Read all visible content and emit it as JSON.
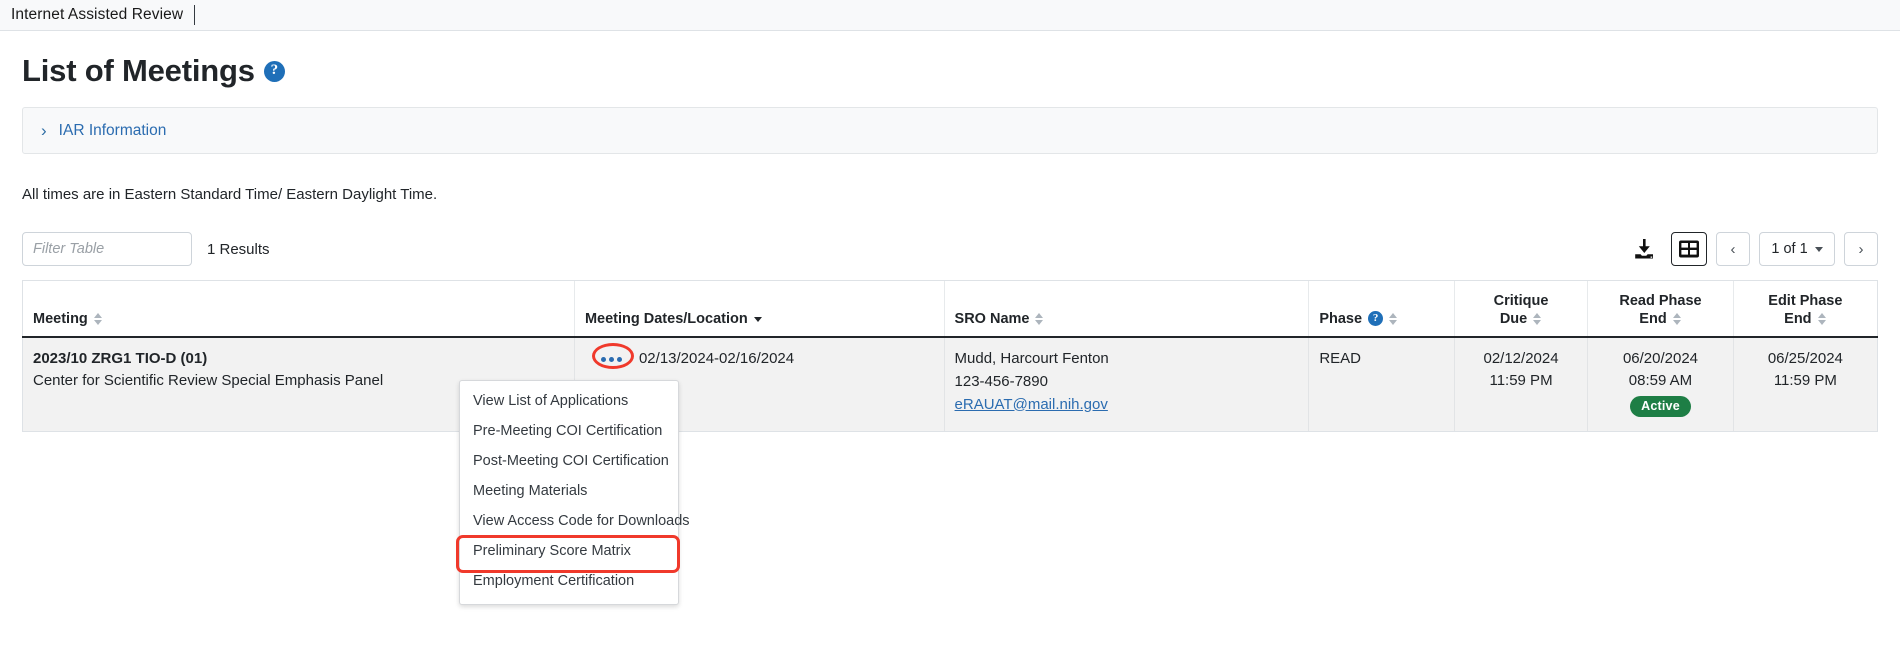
{
  "appbar": {
    "title": "Internet Assisted Review"
  },
  "page": {
    "title": "List of Meetings",
    "help_icon": "question-mark-icon",
    "accordion_label": "IAR Information",
    "times_note": "All times are in Eastern Standard Time/ Eastern Daylight Time."
  },
  "toolbar": {
    "filter_placeholder": "Filter Table",
    "filter_value": "",
    "results_count": "1 Results",
    "download_icon": "download-icon",
    "grid_icon": "grid-view-icon",
    "prev_label": "‹",
    "next_label": "›",
    "page_indicator": "1 of 1"
  },
  "table": {
    "columns": [
      {
        "label": "Meeting",
        "align": "left",
        "sort": "none"
      },
      {
        "label": "Meeting Dates/Location",
        "align": "left",
        "sort": "desc"
      },
      {
        "label": "SRO Name",
        "align": "left",
        "sort": "none"
      },
      {
        "label": "Phase",
        "align": "left",
        "sort": "none",
        "help": true
      },
      {
        "label_line1": "Critique",
        "label_line2": "Due",
        "align": "center",
        "sort": "none"
      },
      {
        "label_line1": "Read Phase",
        "label_line2": "End",
        "align": "center",
        "sort": "none"
      },
      {
        "label_line1": "Edit Phase",
        "label_line2": "End",
        "align": "center",
        "sort": "none"
      }
    ],
    "rows": [
      {
        "meeting_id": "2023/10 ZRG1 TIO-D (01)",
        "meeting_name": "Center for Scientific Review Special Emphasis Panel",
        "dates": "02/13/2024-02/16/2024",
        "sro_name": "Mudd, Harcourt Fenton",
        "sro_phone": "123-456-7890",
        "sro_email": "eRAUAT@mail.nih.gov",
        "phase": "READ",
        "critique_due_date": "02/12/2024",
        "critique_due_time": "11:59 PM",
        "read_phase_end_date": "06/20/2024",
        "read_phase_end_time": "08:59 AM",
        "read_phase_badge": "Active",
        "edit_phase_end_date": "06/25/2024",
        "edit_phase_end_time": "11:59 PM"
      }
    ]
  },
  "dropdown": {
    "items": [
      {
        "label": "View List of Applications",
        "highlighted": false
      },
      {
        "label": "Pre-Meeting COI Certification",
        "highlighted": false
      },
      {
        "label": "Post-Meeting COI Certification",
        "highlighted": false
      },
      {
        "label": "Meeting Materials",
        "highlighted": false
      },
      {
        "label": "View Access Code for Downloads",
        "highlighted": false
      },
      {
        "label": "Preliminary Score Matrix",
        "highlighted": true
      },
      {
        "label": "Employment Certification",
        "highlighted": false
      }
    ]
  },
  "colors": {
    "link": "#2b6cb0",
    "highlight": "#f0392b",
    "badge_active": "#1e7e45",
    "help_blue": "#1f6fb8"
  }
}
